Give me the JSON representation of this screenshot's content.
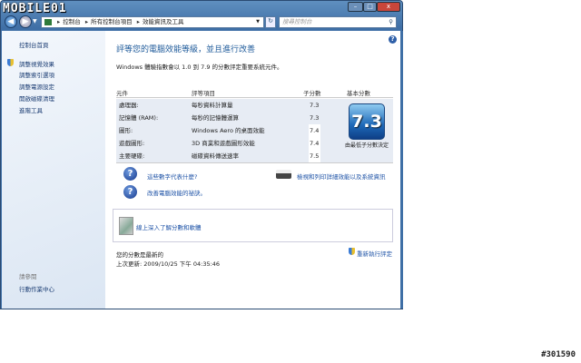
{
  "watermark_logo": "MOBILE01",
  "address": {
    "breadcrumb": [
      "控制台",
      "所有控制台項目",
      "效能資訊及工具"
    ],
    "search_placeholder": "搜尋控制台"
  },
  "sidebar": {
    "home": "控制台首頁",
    "items": [
      "調整視覺效果",
      "調整索引選項",
      "調整電源設定",
      "開啟磁碟清理",
      "進階工具"
    ],
    "see_also_label": "請參閱",
    "see_also": [
      "行動作業中心"
    ]
  },
  "main": {
    "title": "評等您的電腦效能等級，並且進行改善",
    "subtitle": "Windows 體驗指數會以 1.0 到 7.9 的分數評定重要系統元件。",
    "headers": [
      "元件",
      "評等項目",
      "子分數",
      "基本分數"
    ],
    "rows": [
      {
        "component": "處理器:",
        "rating": "每秒資料計算量",
        "score": "7.3"
      },
      {
        "component": "記憶體 (RAM):",
        "rating": "每秒的記憶體運算",
        "score": "7.3"
      },
      {
        "component": "圖形:",
        "rating": "Windows Aero 的桌面效能",
        "score": "7.4"
      },
      {
        "component": "遊戲圖形:",
        "rating": "3D 商業和遊戲圖形效能",
        "score": "7.4"
      },
      {
        "component": "主要硬碟:",
        "rating": "磁碟資料傳送速率",
        "score": "7.5"
      }
    ],
    "base_score": "7.3",
    "base_caption": "由最低子分數決定",
    "link_numbers": "這些數字代表什麼?",
    "link_tips": "改善電腦效能的祕訣。",
    "link_print": "檢視和列印詳細效能以及系統資訊",
    "link_online": "線上深入了解分數和軟體",
    "status": "您的分數是最新的",
    "last_update": "上次更新: 2009/10/25 下午 04:35:46",
    "rerun": "重新執行評定"
  },
  "image_id": "#301590"
}
